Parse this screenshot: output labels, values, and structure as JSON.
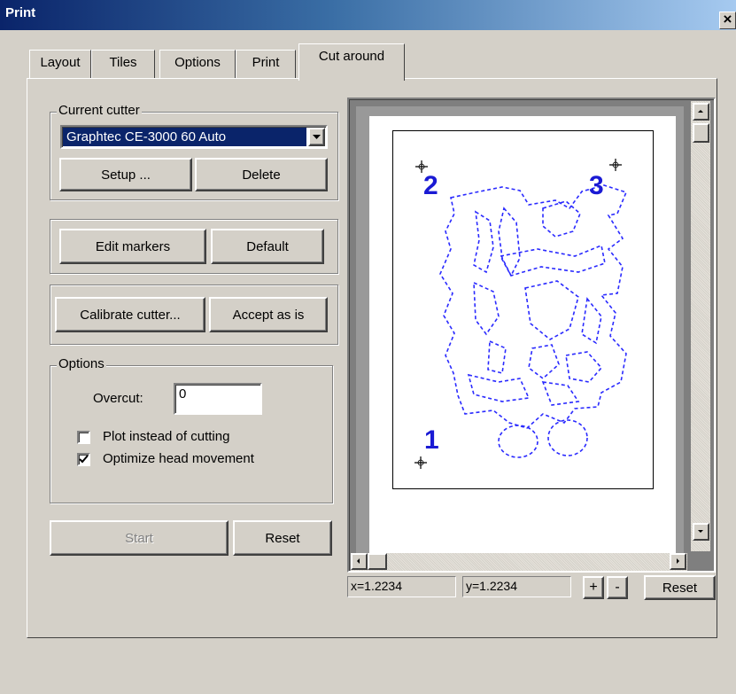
{
  "window": {
    "title": "Print",
    "close_label": "×"
  },
  "tabs": [
    "Layout",
    "Tiles",
    "Options",
    "Print",
    "Cut around"
  ],
  "current_cutter": {
    "label": "Current cutter",
    "selected": "Graphtec CE-3000 60 Auto",
    "setup_label": "Setup ...",
    "delete_label": "Delete"
  },
  "markers": {
    "edit_label": "Edit markers",
    "default_label": "Default"
  },
  "calibrate": {
    "calibrate_label": "Calibrate cutter...",
    "accept_label": "Accept as is"
  },
  "options": {
    "label": "Options",
    "overcut_label": "Overcut:",
    "overcut_value": "0",
    "plot_label": "Plot instead of cutting",
    "plot_checked": false,
    "optimize_label": "Optimize head movement",
    "optimize_checked": true
  },
  "actions": {
    "start_label": "Start",
    "reset_label": "Reset"
  },
  "preview": {
    "markers": [
      "1",
      "2",
      "3"
    ],
    "x_readout": "x=1.2234",
    "y_readout": "y=1.2234",
    "zoom_in_label": "+",
    "zoom_out_label": "-",
    "reset_label": "Reset"
  },
  "colors": {
    "title_bar": "#0a246a",
    "marker_text": "#1a1ad4",
    "cut_line": "#2a2aff"
  }
}
